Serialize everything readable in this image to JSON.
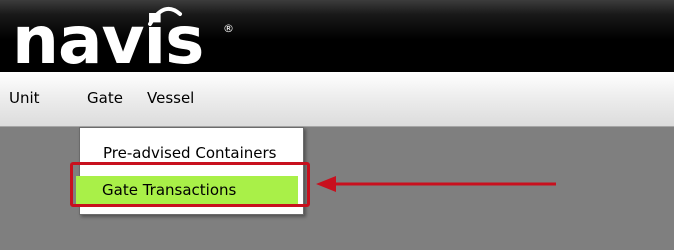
{
  "header": {
    "logo_text": "navis",
    "logo_mark": "®"
  },
  "menubar": {
    "items": [
      {
        "label": "Unit"
      },
      {
        "label": "Gate"
      },
      {
        "label": "Vessel"
      }
    ]
  },
  "dropdown": {
    "parent": "Gate",
    "items": [
      {
        "label": "Pre-advised Containers"
      },
      {
        "label": "Gate Transactions",
        "highlighted": true
      }
    ]
  },
  "annotation": {
    "highlight_color": "#a9f048",
    "callout_color": "#c8101e",
    "arrow_icon": "left-arrow-icon"
  }
}
